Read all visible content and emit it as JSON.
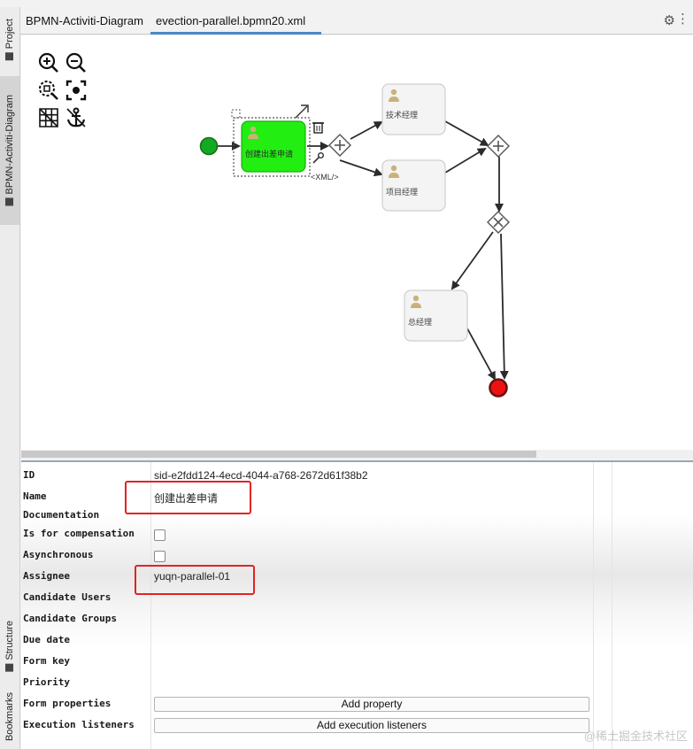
{
  "sidebar": {
    "project_label": "Project",
    "diagram_label": "BPMN-Activiti-Diagram",
    "structure_label": "Structure",
    "bookmarks_label": "Bookmarks"
  },
  "tabs": [
    {
      "label": "BPMN-Activiti-Diagram",
      "active": false
    },
    {
      "label": "evection-parallel.bpmn20.xml",
      "active": true
    }
  ],
  "icons": {
    "settings": "gear-icon",
    "more": "more-icon",
    "zoom_in": "zoom-in-icon",
    "zoom_out": "zoom-out-icon",
    "zoom_fit": "zoom-fit-icon",
    "center": "center-icon",
    "grid": "grid-icon",
    "anchor": "anchor-icon"
  },
  "diagram": {
    "nodes": {
      "apply_task": "创建出差申请",
      "tech_manager": "技术经理",
      "project_manager": "项目经理",
      "general_manager": "总经理"
    },
    "xml_badge": "<XML/>",
    "colors": {
      "selected_task": "#22ee11",
      "start_event": "#11aa22",
      "end_event": "#ee1111"
    }
  },
  "properties": [
    {
      "label": "ID",
      "value": "sid-e2fdd124-4ecd-4044-a768-2672d61f38b2",
      "kind": "text"
    },
    {
      "label": "Name",
      "value": "创建出差申请",
      "kind": "text"
    },
    {
      "label": "Documentation",
      "value": "",
      "kind": "text"
    },
    {
      "label": "Is for compensation",
      "value": "",
      "kind": "checkbox"
    },
    {
      "label": "Asynchronous",
      "value": "",
      "kind": "checkbox"
    },
    {
      "label": "Assignee",
      "value": "yuqn-parallel-01",
      "kind": "text"
    },
    {
      "label": "Candidate Users",
      "value": "",
      "kind": "text"
    },
    {
      "label": "Candidate Groups",
      "value": "",
      "kind": "text"
    },
    {
      "label": "Due date",
      "value": "",
      "kind": "text"
    },
    {
      "label": "Form key",
      "value": "",
      "kind": "text"
    },
    {
      "label": "Priority",
      "value": "",
      "kind": "text"
    },
    {
      "label": "Form properties",
      "value": "Add property",
      "kind": "button"
    },
    {
      "label": "Execution listeners",
      "value": "Add execution listeners",
      "kind": "button"
    }
  ],
  "watermark": "@稀土掘金技术社区"
}
